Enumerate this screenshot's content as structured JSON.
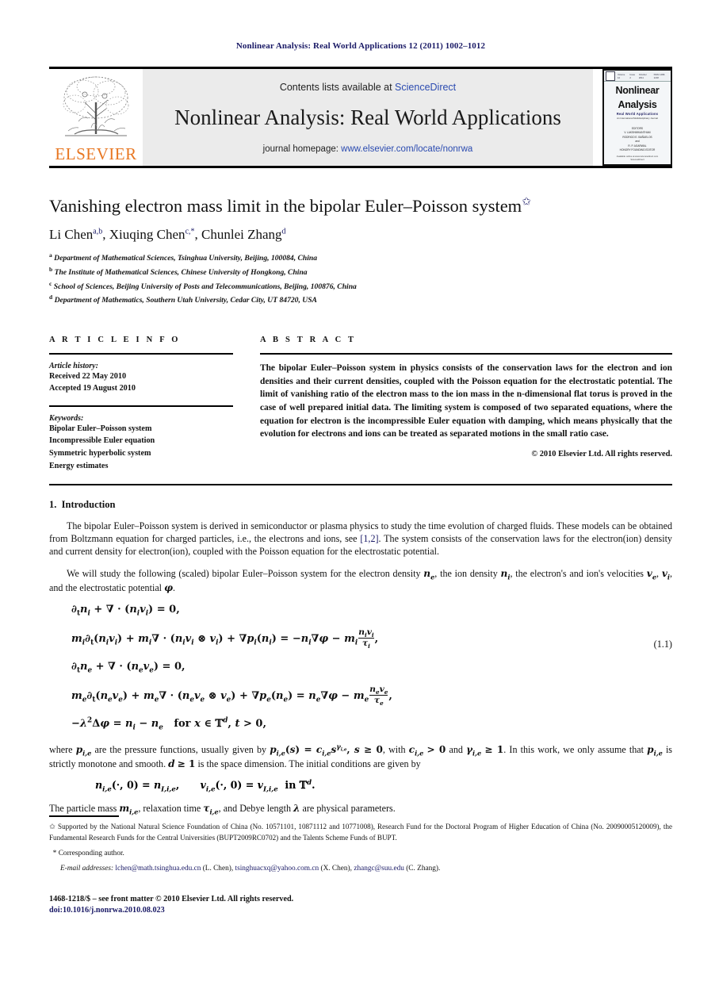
{
  "running_head": "Nonlinear Analysis: Real World Applications 12 (2011) 1002–1012",
  "masthead": {
    "publisher": "ELSEVIER",
    "contents_prefix": "Contents lists available at ",
    "contents_link": "ScienceDirect",
    "journal_title": "Nonlinear Analysis: Real World Applications",
    "homepage_prefix": "journal homepage: ",
    "homepage_link": "www.elsevier.com/locate/nonrwa",
    "cover": {
      "volume": "Volume 12",
      "issue": "Issue 2",
      "date": "October 2011",
      "issn": "ISSN 1468-1218",
      "title_line1": "Nonlinear",
      "title_line2": "Analysis",
      "subtitle": "Real World Applications",
      "subtitle2": "An International Multidisciplinary Journal",
      "editors": "EDITORS\nV. LAKSHMIKANTHAM\nRODRIGO E. BAÑUELOS\nand\nR. P. AGARWAL\nHONORY FOUNDING EDITOR",
      "footer": "Available online at www.sciencedirect.com\nScienceDirect"
    }
  },
  "article": {
    "title": "Vanishing electron mass limit in the bipolar Euler–Poisson system",
    "title_marker": "✩",
    "authors_plain": "Li Chen a,b, Xiuqing Chen c,*, Chunlei Zhang d",
    "authors": [
      {
        "name": "Li Chen",
        "sup": "a,b",
        "sep": ", "
      },
      {
        "name": "Xiuqing Chen",
        "sup": "c,*",
        "sep": ", "
      },
      {
        "name": "Chunlei Zhang",
        "sup": "d",
        "sep": ""
      }
    ],
    "affiliations": [
      {
        "marker": "a",
        "text": "Department of Mathematical Sciences, Tsinghua University, Beijing, 100084, China"
      },
      {
        "marker": "b",
        "text": "The Institute of Mathematical Sciences, Chinese University of Hongkong, China"
      },
      {
        "marker": "c",
        "text": "School of Sciences, Beijing University of Posts and Telecommunications, Beijing, 100876, China"
      },
      {
        "marker": "d",
        "text": "Department of Mathematics, Southern Utah University, Cedar City, UT 84720, USA"
      }
    ]
  },
  "article_info": {
    "heading": "A R T I C L E   I N F O",
    "history_label": "Article history:",
    "received": "Received 22 May 2010",
    "accepted": "Accepted 19 August 2010",
    "keywords_label": "Keywords:",
    "keywords": [
      "Bipolar Euler–Poisson system",
      "Incompressible Euler equation",
      "Symmetric hyperbolic system",
      "Energy estimates"
    ]
  },
  "abstract": {
    "heading": "A B S T R A C T",
    "text": "The bipolar Euler–Poisson system in physics consists of the conservation laws for the electron and ion densities and their current densities, coupled with the Poisson equation for the electrostatic potential. The limit of vanishing ratio of the electron mass to the ion mass in the n-dimensional flat torus is proved in the case of well prepared initial data. The limiting system is composed of two separated equations, where the equation for electron is the incompressible Euler equation with damping, which means physically that the evolution for electrons and ions can be treated as separated motions in the small ratio case.",
    "copyright": "© 2010 Elsevier Ltd. All rights reserved."
  },
  "body": {
    "section_number": "1.",
    "section_title": "Introduction",
    "paragraph1": "The bipolar Euler–Poisson system is derived in semiconductor or plasma physics to study the time evolution of charged fluids. These models can be obtained from Boltzmann equation for charged particles, i.e., the electrons and ions, see [1,2]. The system consists of the conservation laws for the electron(ion) density and current density for electron(ion), coupled with the Poisson equation for the electrostatic potential.",
    "paragraph1_ref": "[1,2]",
    "paragraph2": "We will study the following (scaled) bipolar Euler–Poisson system for the electron density nₑ, the ion density nᵢ, the electron's and ion's velocities vₑ, vᵢ, and the electrostatic potential φ.",
    "equation_number": "(1.1)",
    "equations": [
      "∂ₜnᵢ + ∇ · (nᵢvᵢ) = 0,",
      "mᵢ∂ₜ(nᵢvᵢ) + mᵢ∇ · (nᵢvᵢ ⊗ vᵢ) + ∇pᵢ(nᵢ) = −nᵢ∇φ − mᵢ nᵢvᵢ/τᵢ,",
      "∂ₜnₑ + ∇ · (nₑvₑ) = 0,",
      "mₑ∂ₜ(nₑvₑ) + mₑ∇ · (nₑvₑ ⊗ vₑ) + ∇pₑ(nₑ) = nₑ∇φ − mₑ nₑvₑ/τₑ,",
      "−λ²Δφ = nᵢ − nₑ   for x ∈ 𝕋ᵈ, t > 0,"
    ],
    "paragraph3": "where pᵢ,ₑ are the pressure functions, usually given by pᵢ,ₑ(s) = cᵢ,ₑs^γᵢ,ₑ, s ≥ 0, with cᵢ,ₑ > 0 and γᵢ,ₑ ≥ 1. In this work, we only assume that pᵢ,ₑ is strictly monotone and smooth. d ≥ 1 is the space dimension. The initial conditions are given by",
    "equation_initial": "nᵢ,ₑ(·, 0) = nᴵ,ᵢ,ₑ,      vᵢ,ₑ(·, 0) = vᴵ,ᵢ,ₑ  in 𝕋ᵈ,",
    "paragraph4": "The particle mass mᵢ,ₑ, relaxation time τᵢ,ₑ, and Debye length λ are physical parameters."
  },
  "footnotes": {
    "funding_marker": "✩",
    "funding": "Supported by the National Natural Science Foundation of China (No. 10571101, 10871112 and 10771008), Research Fund for the Doctoral Program of Higher Education of China (No. 20090005120009), the Fundamental Research Funds for the Central Universities (BUPT2009RC0702) and the Talents Scheme Funds of BUPT.",
    "corresponding_marker": "*",
    "corresponding": "Corresponding author.",
    "email_label": "E-mail addresses:",
    "emails": [
      {
        "address": "lchen@math.tsinghua.edu.cn",
        "person": "(L. Chen)",
        "sep": ", "
      },
      {
        "address": "tsinghuacxq@yahoo.com.cn",
        "person": "(X. Chen)",
        "sep": ", "
      },
      {
        "address": "zhangc@suu.edu",
        "person": "(C. Zhang).",
        "sep": ""
      }
    ]
  },
  "footer": {
    "issn_line": "1468-1218/$ – see front matter © 2010 Elsevier Ltd. All rights reserved.",
    "doi": "doi:10.1016/j.nonrwa.2010.08.023"
  },
  "colors": {
    "link": "#1a1a66",
    "elsevier_orange": "#E87722",
    "sciencedirect_blue": "#2b4bb0",
    "masthead_gray": "#ebebeb"
  }
}
